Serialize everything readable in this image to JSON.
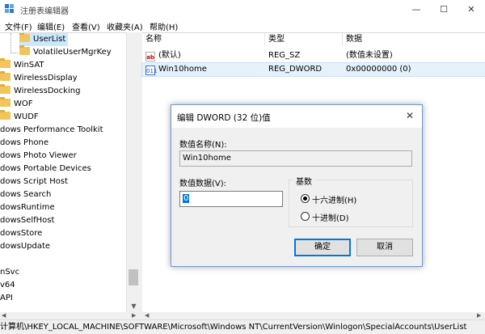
{
  "window": {
    "title": "注册表编辑器",
    "minimize_glyph": "—",
    "maximize_glyph": "☐",
    "close_glyph": "✕"
  },
  "menu": [
    "文件(F)",
    "编辑(E)",
    "查看(V)",
    "收藏夹(A)",
    "帮助(H)"
  ],
  "tree": {
    "items": [
      {
        "label": "UserList",
        "folder": true,
        "selected": true
      },
      {
        "label": "VolatileUserMgrKey",
        "folder": true,
        "selected": false
      },
      {
        "label": "WinSAT",
        "folder": true,
        "selected": false
      },
      {
        "label": "WirelessDisplay",
        "folder": true,
        "selected": false
      },
      {
        "label": "WirelessDocking",
        "folder": true,
        "selected": false
      },
      {
        "label": "WOF",
        "folder": true,
        "selected": false
      },
      {
        "label": "WUDF",
        "folder": true,
        "selected": false
      },
      {
        "label": "dows Performance Toolkit",
        "folder": false,
        "selected": false
      },
      {
        "label": "dows Phone",
        "folder": false,
        "selected": false
      },
      {
        "label": "dows Photo Viewer",
        "folder": false,
        "selected": false
      },
      {
        "label": "dows Portable Devices",
        "folder": false,
        "selected": false
      },
      {
        "label": "dows Script Host",
        "folder": false,
        "selected": false
      },
      {
        "label": "dows Search",
        "folder": false,
        "selected": false
      },
      {
        "label": "dowsRuntime",
        "folder": false,
        "selected": false
      },
      {
        "label": "dowsSelfHost",
        "folder": false,
        "selected": false
      },
      {
        "label": "dowsStore",
        "folder": false,
        "selected": false
      },
      {
        "label": "dowsUpdate",
        "folder": false,
        "selected": false
      },
      {
        "label": "",
        "folder": false,
        "selected": false
      },
      {
        "label": "nSvc",
        "folder": false,
        "selected": false
      },
      {
        "label": "v64",
        "folder": false,
        "selected": false
      },
      {
        "label": "API",
        "folder": false,
        "selected": false
      }
    ]
  },
  "list": {
    "columns": [
      "名称",
      "类型",
      "数据"
    ],
    "rows": [
      {
        "name": "(默认)",
        "type": "REG_SZ",
        "data": "(数值未设置)",
        "icon": "ab"
      },
      {
        "name": "Win10home",
        "type": "REG_DWORD",
        "data": "0x00000000 (0)",
        "icon": "011"
      }
    ]
  },
  "status": "计算机\\HKEY_LOCAL_MACHINE\\SOFTWARE\\Microsoft\\Windows NT\\CurrentVersion\\Winlogon\\SpecialAccounts\\UserList",
  "dialog": {
    "title": "编辑 DWORD (32 位)值",
    "name_label": "数值名称(N):",
    "name_value": "Win10home",
    "data_label": "数值数据(V):",
    "data_value": "0",
    "base_label": "基数",
    "base_options": [
      "十六进制(H)",
      "十进制(D)"
    ],
    "base_selected": "十六进制(H)",
    "ok_label": "确定",
    "cancel_label": "取消"
  }
}
